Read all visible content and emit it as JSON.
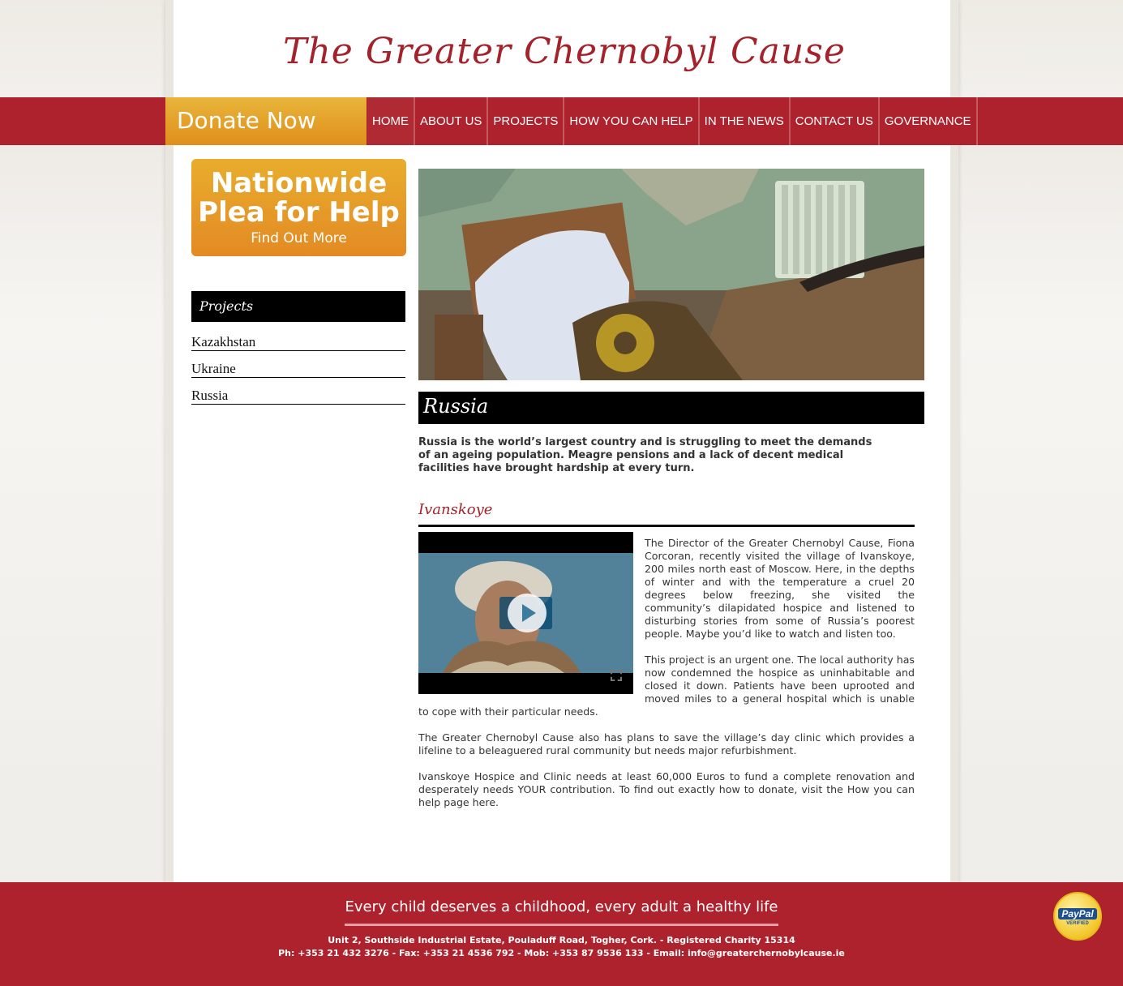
{
  "site": {
    "title": "The Greater Chernobyl Cause"
  },
  "nav": {
    "donate": "Donate Now",
    "items": [
      "HOME",
      "ABOUT US",
      "PROJECTS",
      "HOW YOU CAN HELP",
      "IN THE NEWS",
      "CONTACT US",
      "GOVERNANCE"
    ]
  },
  "sidebar": {
    "plea": {
      "title_line1": "Nationwide",
      "title_line2": "Plea for Help",
      "link": "Find Out More"
    },
    "heading": "Projects",
    "items": [
      "Kazakhstan",
      "Ukraine",
      "Russia"
    ]
  },
  "main": {
    "heading": "Russia",
    "intro": "Russia is the world’s largest country and is struggling to meet the demands of an ageing population. Meagre pensions and a lack of decent medical facilities have brought hardship at every turn.",
    "subheading": "Ivanskoye",
    "paragraphs": [
      "The Director of the Greater Chernobyl Cause, Fiona Corcoran, recently visited the village of Ivanskoye, 200 miles north east of Moscow. Here, in the depths of winter and with the temperature a cruel 20 degrees below freezing, she visited the community’s dilapidated hospice and listened to disturbing stories from some of Russia’s poorest people. Maybe you’d like to watch and listen too.",
      "This project is an urgent one. The local authority has now condemned the hospice as uninhabitable and closed it down. Patients have been uprooted and moved miles to a general hospital which is unable to cope with their particular needs.",
      "The Greater Chernobyl Cause also has plans to save the village’s day clinic which provides a lifeline to a beleaguered rural community but needs major refurbishment.",
      "Ivanskoye Hospice and Clinic needs at least 60,000 Euros to fund a complete renovation and desperately needs YOUR contribution. To find out exactly how to donate, visit the How you can help page here."
    ]
  },
  "footer": {
    "tagline": "Every child deserves a childhood, every adult a healthy life",
    "address": "Unit 2, Southside Industrial Estate, Pouladuff Road, Togher, Cork. - Registered Charity 15314",
    "contact": "Ph: +353 21 432 3276 - Fax: +353 21 4536 792 - Mob: +353 87 9536 133 - Email: info@greaterchernobylcause.ie",
    "badge_line1": "PayPal",
    "badge_line2": "VERIFIED"
  },
  "colors": {
    "brand_red": "#ad222c",
    "donate_orange": "#e39a22",
    "title_red": "#a3222b"
  }
}
